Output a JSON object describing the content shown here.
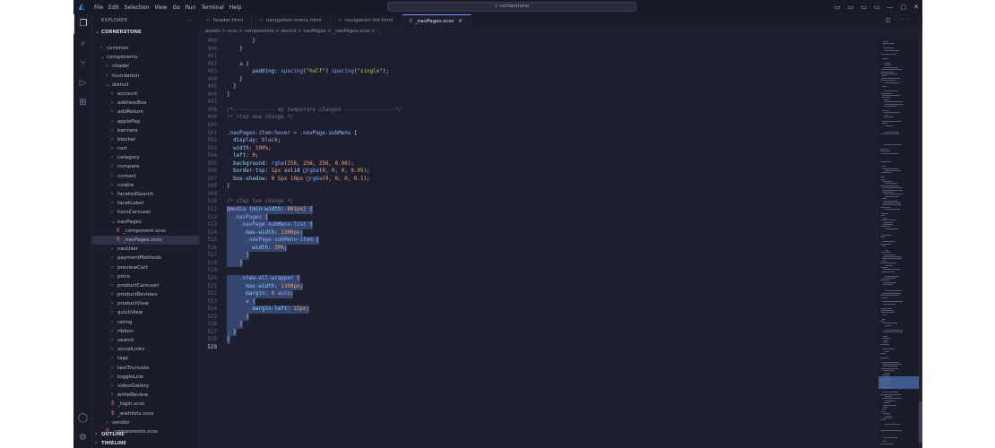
{
  "app": {
    "menu": [
      "File",
      "Edit",
      "Selection",
      "View",
      "Go",
      "Run",
      "Terminal",
      "Help"
    ],
    "command_center": "cornerstone",
    "window_controls": [
      "▭",
      "▭",
      "▭",
      "▭",
      "—",
      "▢",
      "✕"
    ]
  },
  "sidebar": {
    "title": "EXPLORER",
    "more": "···",
    "root": "CORNERSTONE",
    "tree": [
      {
        "label": "common",
        "depth": 1,
        "type": "folder",
        "open": false
      },
      {
        "label": "components",
        "depth": 1,
        "type": "folder",
        "open": true
      },
      {
        "label": "citadel",
        "depth": 2,
        "type": "folder",
        "open": false
      },
      {
        "label": "foundation",
        "depth": 2,
        "type": "folder",
        "open": false
      },
      {
        "label": "stencil",
        "depth": 2,
        "type": "folder",
        "open": true
      },
      {
        "label": "account",
        "depth": 3,
        "type": "folder",
        "open": false
      },
      {
        "label": "addressBox",
        "depth": 3,
        "type": "folder",
        "open": false
      },
      {
        "label": "addReturn",
        "depth": 3,
        "type": "folder",
        "open": false
      },
      {
        "label": "applePay",
        "depth": 3,
        "type": "folder",
        "open": false
      },
      {
        "label": "banners",
        "depth": 3,
        "type": "folder",
        "open": false
      },
      {
        "label": "blocker",
        "depth": 3,
        "type": "folder",
        "open": false
      },
      {
        "label": "cart",
        "depth": 3,
        "type": "folder",
        "open": false
      },
      {
        "label": "category",
        "depth": 3,
        "type": "folder",
        "open": false
      },
      {
        "label": "compare",
        "depth": 3,
        "type": "folder",
        "open": false
      },
      {
        "label": "contact",
        "depth": 3,
        "type": "folder",
        "open": false
      },
      {
        "label": "cookie",
        "depth": 3,
        "type": "folder",
        "open": false
      },
      {
        "label": "facetedSearch",
        "depth": 3,
        "type": "folder",
        "open": false
      },
      {
        "label": "facetLabel",
        "depth": 3,
        "type": "folder",
        "open": false
      },
      {
        "label": "heroCarousel",
        "depth": 3,
        "type": "folder",
        "open": false
      },
      {
        "label": "navPages",
        "depth": 3,
        "type": "folder",
        "open": true
      },
      {
        "label": "_component.scss",
        "depth": 4,
        "type": "file"
      },
      {
        "label": "_navPages.scss",
        "depth": 4,
        "type": "file",
        "selected": true
      },
      {
        "label": "navUser",
        "depth": 3,
        "type": "folder",
        "open": false
      },
      {
        "label": "paymentMethods",
        "depth": 3,
        "type": "folder",
        "open": false
      },
      {
        "label": "previewCart",
        "depth": 3,
        "type": "folder",
        "open": false
      },
      {
        "label": "price",
        "depth": 3,
        "type": "folder",
        "open": false
      },
      {
        "label": "productCarousel",
        "depth": 3,
        "type": "folder",
        "open": false
      },
      {
        "label": "productReviews",
        "depth": 3,
        "type": "folder",
        "open": false
      },
      {
        "label": "productView",
        "depth": 3,
        "type": "folder",
        "open": false
      },
      {
        "label": "quickView",
        "depth": 3,
        "type": "folder",
        "open": false
      },
      {
        "label": "rating",
        "depth": 3,
        "type": "folder",
        "open": false
      },
      {
        "label": "ribbon",
        "depth": 3,
        "type": "folder",
        "open": false
      },
      {
        "label": "search",
        "depth": 3,
        "type": "folder",
        "open": false
      },
      {
        "label": "socialLinks",
        "depth": 3,
        "type": "folder",
        "open": false
      },
      {
        "label": "tags",
        "depth": 3,
        "type": "folder",
        "open": false
      },
      {
        "label": "textTruncate",
        "depth": 3,
        "type": "folder",
        "open": false
      },
      {
        "label": "toggleLink",
        "depth": 3,
        "type": "folder",
        "open": false
      },
      {
        "label": "videoGallery",
        "depth": 3,
        "type": "folder",
        "open": false
      },
      {
        "label": "writeReview",
        "depth": 3,
        "type": "folder",
        "open": false
      },
      {
        "label": "_login.scss",
        "depth": 3,
        "type": "file"
      },
      {
        "label": "_wishlists.scss",
        "depth": 3,
        "type": "file"
      },
      {
        "label": "vendor",
        "depth": 2,
        "type": "folder",
        "open": false
      },
      {
        "label": "_components.scss",
        "depth": 2,
        "type": "file"
      }
    ],
    "outline": "OUTLINE",
    "timeline": "TIMELINE"
  },
  "tabs": [
    {
      "label": "header.html",
      "kind": "html"
    },
    {
      "label": "navigation-menu.html",
      "kind": "html"
    },
    {
      "label": "navigation-list.html",
      "kind": "html"
    },
    {
      "label": "_navPages.scss",
      "kind": "scss",
      "active": true
    }
  ],
  "breadcrumb": "assets > scss > components > stencil > navPages > _navPages.scss > ...",
  "code": [
    {
      "n": "489",
      "parts": [
        [
          "p",
          "        }"
        ]
      ]
    },
    {
      "n": "490",
      "parts": [
        [
          "p",
          "    }"
        ]
      ]
    },
    {
      "n": "491",
      "parts": [
        [
          "p",
          ""
        ]
      ]
    },
    {
      "n": "492",
      "parts": [
        [
          "p",
          "    "
        ],
        [
          "sel",
          "a"
        ],
        [
          "p",
          " {"
        ]
      ]
    },
    {
      "n": "493",
      "parts": [
        [
          "p",
          "        "
        ],
        [
          "prop",
          "padding"
        ],
        [
          "p",
          ": "
        ],
        [
          "fn",
          "spacing"
        ],
        [
          "p",
          "("
        ],
        [
          "str",
          "\"half\""
        ],
        [
          "p",
          ") "
        ],
        [
          "fn",
          "spacing"
        ],
        [
          "p",
          "("
        ],
        [
          "str",
          "\"single\""
        ],
        [
          "p",
          ");"
        ]
      ]
    },
    {
      "n": "494",
      "parts": [
        [
          "p",
          "    }"
        ]
      ]
    },
    {
      "n": "495",
      "parts": [
        [
          "p",
          "  }"
        ]
      ]
    },
    {
      "n": "496",
      "parts": [
        [
          "p",
          "}"
        ]
      ]
    },
    {
      "n": "497",
      "parts": [
        [
          "p",
          ""
        ]
      ]
    },
    {
      "n": "498",
      "parts": [
        [
          "com",
          "/*------------- my temporary changes ----------------*/"
        ]
      ]
    },
    {
      "n": "499",
      "parts": [
        [
          "com",
          "/* step one change */"
        ]
      ]
    },
    {
      "n": "500",
      "parts": [
        [
          "p",
          ""
        ]
      ]
    },
    {
      "n": "501",
      "parts": [
        [
          "sel",
          ".navPages-item:hover > .navPage-subMenu"
        ],
        [
          "p",
          " {"
        ]
      ]
    },
    {
      "n": "502",
      "parts": [
        [
          "p",
          "  "
        ],
        [
          "prop",
          "display"
        ],
        [
          "p",
          ": "
        ],
        [
          "kw",
          "block"
        ],
        [
          "p",
          ";"
        ]
      ]
    },
    {
      "n": "503",
      "parts": [
        [
          "p",
          "  "
        ],
        [
          "prop",
          "width"
        ],
        [
          "p",
          ": "
        ],
        [
          "num",
          "100%"
        ],
        [
          "p",
          ";"
        ]
      ]
    },
    {
      "n": "504",
      "parts": [
        [
          "p",
          "  "
        ],
        [
          "prop",
          "left"
        ],
        [
          "p",
          ": "
        ],
        [
          "num",
          "0"
        ],
        [
          "p",
          ";"
        ]
      ]
    },
    {
      "n": "505",
      "parts": [
        [
          "p",
          "  "
        ],
        [
          "prop",
          "background"
        ],
        [
          "p",
          ": "
        ],
        [
          "fn",
          "rgba"
        ],
        [
          "p",
          "("
        ],
        [
          "num",
          "256, 256, 256, 0.96"
        ],
        [
          "p",
          ");"
        ]
      ]
    },
    {
      "n": "506",
      "parts": [
        [
          "p",
          "  "
        ],
        [
          "prop",
          "border-top"
        ],
        [
          "p",
          ": "
        ],
        [
          "num",
          "1px"
        ],
        [
          "p",
          " solid □"
        ],
        [
          "fn",
          "rgba"
        ],
        [
          "p",
          "("
        ],
        [
          "num",
          "0, 0, 0, 0.05"
        ],
        [
          "p",
          ");"
        ]
      ]
    },
    {
      "n": "507",
      "parts": [
        [
          "p",
          "  "
        ],
        [
          "prop",
          "box-shadow"
        ],
        [
          "p",
          ": "
        ],
        [
          "num",
          "0 5px 10px"
        ],
        [
          "p",
          " □"
        ],
        [
          "fn",
          "rgba"
        ],
        [
          "p",
          "("
        ],
        [
          "num",
          "0, 0, 0, 0.1"
        ],
        [
          "p",
          ");"
        ]
      ]
    },
    {
      "n": "508",
      "parts": [
        [
          "p",
          "}"
        ]
      ]
    },
    {
      "n": "509",
      "parts": [
        [
          "p",
          ""
        ]
      ]
    },
    {
      "n": "510",
      "parts": [
        [
          "com",
          "/* step two change */"
        ]
      ]
    },
    {
      "n": "511",
      "hl": true,
      "parts": [
        [
          "kw",
          "@media"
        ],
        [
          "p",
          " ("
        ],
        [
          "prop",
          "min-width"
        ],
        [
          "p",
          ": "
        ],
        [
          "num",
          "801px"
        ],
        [
          "p",
          ") {"
        ]
      ]
    },
    {
      "n": "512",
      "hl": true,
      "parts": [
        [
          "p",
          "  "
        ],
        [
          "sel",
          ".navPages"
        ],
        [
          "p",
          " {"
        ]
      ]
    },
    {
      "n": "513",
      "hl": true,
      "parts": [
        [
          "p",
          "    "
        ],
        [
          "sel",
          ".navPage-subMenu-list"
        ],
        [
          "p",
          " {"
        ]
      ]
    },
    {
      "n": "514",
      "hl": true,
      "parts": [
        [
          "p",
          "      "
        ],
        [
          "prop",
          "max-width"
        ],
        [
          "p",
          ": "
        ],
        [
          "num",
          "1300px"
        ],
        [
          "p",
          ";"
        ]
      ]
    },
    {
      "n": "515",
      "hl": true,
      "parts": [
        [
          "p",
          "      "
        ],
        [
          "sel",
          ".navPage-subMenu-item"
        ],
        [
          "p",
          " {"
        ]
      ]
    },
    {
      "n": "516",
      "hl": true,
      "parts": [
        [
          "p",
          "        "
        ],
        [
          "prop",
          "width"
        ],
        [
          "p",
          ": "
        ],
        [
          "num",
          "20%"
        ],
        [
          "p",
          ";"
        ]
      ]
    },
    {
      "n": "517",
      "hl": true,
      "parts": [
        [
          "p",
          "      }"
        ]
      ]
    },
    {
      "n": "518",
      "hl": true,
      "parts": [
        [
          "p",
          "    }"
        ]
      ]
    },
    {
      "n": "519",
      "parts": [
        [
          "p",
          ""
        ]
      ]
    },
    {
      "n": "520",
      "hl": true,
      "parts": [
        [
          "p",
          "    "
        ],
        [
          "sel",
          ".view-all-wrapper"
        ],
        [
          "p",
          " {"
        ]
      ]
    },
    {
      "n": "521",
      "hl": true,
      "parts": [
        [
          "p",
          "      "
        ],
        [
          "prop",
          "max-width"
        ],
        [
          "p",
          ": "
        ],
        [
          "num",
          "1300px"
        ],
        [
          "p",
          ";"
        ]
      ]
    },
    {
      "n": "522",
      "hl": true,
      "parts": [
        [
          "p",
          "      "
        ],
        [
          "prop",
          "margin"
        ],
        [
          "p",
          ": "
        ],
        [
          "num",
          "0"
        ],
        [
          "p",
          " "
        ],
        [
          "kw",
          "auto"
        ],
        [
          "p",
          ";"
        ]
      ]
    },
    {
      "n": "523",
      "hl": true,
      "parts": [
        [
          "p",
          "      "
        ],
        [
          "sel",
          "a"
        ],
        [
          "p",
          " {"
        ]
      ]
    },
    {
      "n": "524",
      "hl": true,
      "parts": [
        [
          "p",
          "        "
        ],
        [
          "prop",
          "margin-left"
        ],
        [
          "p",
          ": "
        ],
        [
          "num",
          "15px"
        ],
        [
          "p",
          ";"
        ]
      ]
    },
    {
      "n": "525",
      "hl": true,
      "parts": [
        [
          "p",
          "      }"
        ]
      ]
    },
    {
      "n": "526",
      "hl": true,
      "parts": [
        [
          "p",
          "    }"
        ]
      ]
    },
    {
      "n": "527",
      "hl": true,
      "parts": [
        [
          "p",
          "  }"
        ]
      ]
    },
    {
      "n": "528",
      "hl": true,
      "parts": [
        [
          "p",
          "}"
        ]
      ]
    },
    {
      "n": "529",
      "cur": true,
      "parts": [
        [
          "p",
          ""
        ]
      ]
    }
  ],
  "colors": {
    "accent": "#7c8cf5",
    "selection": "#34466e",
    "background": "#1e1f2e"
  }
}
